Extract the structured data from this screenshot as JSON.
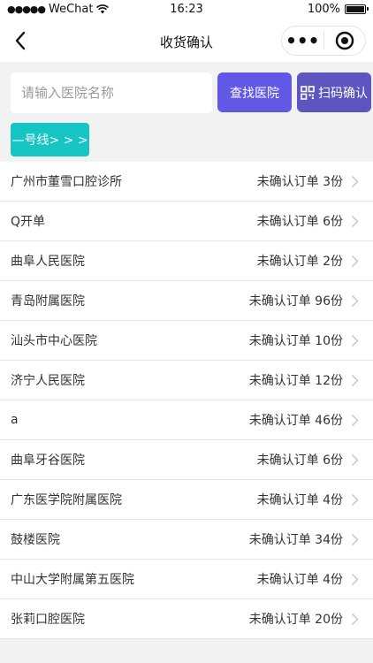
{
  "status_bar": {
    "signal": "●●●●●",
    "carrier": "WeChat",
    "time": "16:23",
    "battery_percent": "100%",
    "battery_level": 1.0
  },
  "nav": {
    "title": "收货确认",
    "more_label": "•••"
  },
  "search": {
    "placeholder": "请输入医院名称",
    "find_label": "查找医院",
    "scan_label": "扫码确认",
    "line_label": "—号线> > >"
  },
  "colors": {
    "find_button": "#6159e6",
    "scan_button": "#5d56c0",
    "line_button": "#16c4c4"
  },
  "hospitals": [
    {
      "name": "广州市董雪口腔诊所",
      "count": "未确认订单 3份"
    },
    {
      "name": "Q开单",
      "count": "未确认订单 6份"
    },
    {
      "name": "曲阜人民医院",
      "count": "未确认订单 2份"
    },
    {
      "name": "青岛附属医院",
      "count": "未确认订单 96份"
    },
    {
      "name": "汕头市中心医院",
      "count": "未确认订单 10份"
    },
    {
      "name": "济宁人民医院",
      "count": "未确认订单 12份"
    },
    {
      "name": "a",
      "count": "未确认订单 46份"
    },
    {
      "name": "曲阜牙谷医院",
      "count": "未确认订单 6份"
    },
    {
      "name": "广东医学院附属医院",
      "count": "未确认订单 4份"
    },
    {
      "name": "鼓楼医院",
      "count": "未确认订单 34份"
    },
    {
      "name": "中山大学附属第五医院",
      "count": "未确认订单 4份"
    },
    {
      "name": "张莉口腔医院",
      "count": "未确认订单 20份"
    }
  ]
}
